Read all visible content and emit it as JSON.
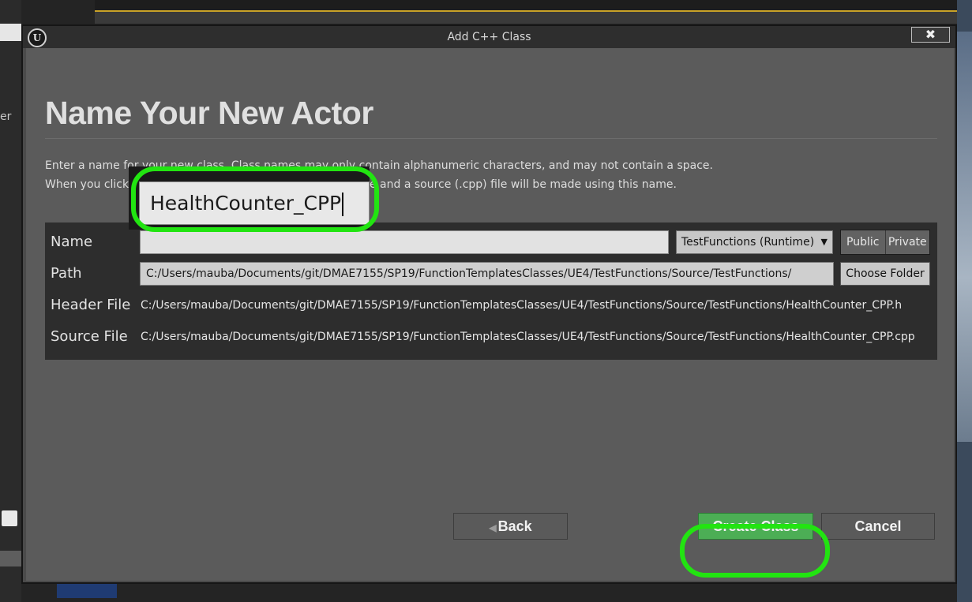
{
  "window": {
    "title": "Add C++ Class",
    "close_label": "✖"
  },
  "page": {
    "heading": "Name Your New Actor",
    "description_line1": "Enter a name for your new class. Class names may only contain alphanumeric characters, and may not contain a space.",
    "description_line2": "When you click the \"Create\" button below, a header (.h) file and a source (.cpp) file will be made using this name."
  },
  "form": {
    "name_label": "Name",
    "name_value": "HealthCounter_CPP",
    "module_selected": "TestFunctions (Runtime)",
    "visibility_options": [
      "Public",
      "Private"
    ],
    "path_label": "Path",
    "path_value": "C:/Users/mauba/Documents/git/DMAE7155/SP19/FunctionTemplatesClasses/UE4/TestFunctions/Source/TestFunctions/",
    "choose_folder_label": "Choose Folder",
    "header_file_label": "Header File",
    "header_file_value": "C:/Users/mauba/Documents/git/DMAE7155/SP19/FunctionTemplatesClasses/UE4/TestFunctions/Source/TestFunctions/HealthCounter_CPP.h",
    "source_file_label": "Source File",
    "source_file_value": "C:/Users/mauba/Documents/git/DMAE7155/SP19/FunctionTemplatesClasses/UE4/TestFunctions/Source/TestFunctions/HealthCounter_CPP.cpp"
  },
  "buttons": {
    "back": "Back",
    "create": "Create Class",
    "cancel": "Cancel"
  },
  "background": {
    "left_text_fragment": "er"
  },
  "colors": {
    "highlight_ring": "#22e411",
    "create_button": "#4cae55"
  }
}
